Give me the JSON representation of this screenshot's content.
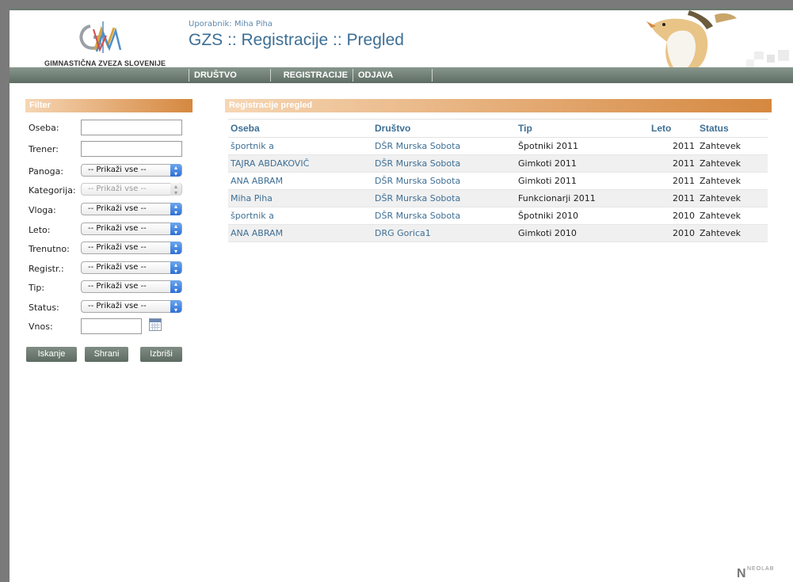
{
  "header": {
    "logo_text": "GIMNASTIČNA ZVEZA SLOVENIJE",
    "user_label": "Uporabnik: Miha Piha",
    "title": "GZS :: Registracije :: Pregled"
  },
  "nav": {
    "items": [
      {
        "label": "DRUŠTVO"
      },
      {
        "label": "REGISTRACIJE"
      },
      {
        "label": "ODJAVA"
      }
    ]
  },
  "filter": {
    "heading": "Filter",
    "fields": {
      "oseba": {
        "label": "Oseba:",
        "value": ""
      },
      "trener": {
        "label": "Trener:",
        "value": ""
      },
      "panoga": {
        "label": "Panoga:",
        "selected": "-- Prikaži vse --"
      },
      "kategorija": {
        "label": "Kategorija:",
        "selected": "-- Prikaži vse --"
      },
      "vloga": {
        "label": "Vloga:",
        "selected": "-- Prikaži vse --"
      },
      "leto": {
        "label": "Leto:",
        "selected": "-- Prikaži vse --"
      },
      "trenutno": {
        "label": "Trenutno:",
        "selected": "-- Prikaži vse --"
      },
      "registr": {
        "label": "Registr.:",
        "selected": "-- Prikaži vse --"
      },
      "tip": {
        "label": "Tip:",
        "selected": "-- Prikaži vse --"
      },
      "status": {
        "label": "Status:",
        "selected": "-- Prikaži vse --"
      },
      "vnos": {
        "label": "Vnos:",
        "value": ""
      }
    },
    "buttons": {
      "search": "Iskanje",
      "save": "Shrani",
      "delete": "Izbriši"
    }
  },
  "grid": {
    "heading": "Registracije pregled",
    "columns": [
      "Oseba",
      "Društvo",
      "Tip",
      "Leto",
      "Status"
    ],
    "rows": [
      {
        "oseba": "športnik a",
        "drustvo": "DŠR Murska Sobota",
        "tip": "Špotniki 2011",
        "leto": "2011",
        "status": "Zahtevek"
      },
      {
        "oseba": "TAJRA ABDAKOVIČ",
        "drustvo": "DŠR Murska Sobota",
        "tip": "Gimkoti 2011",
        "leto": "2011",
        "status": "Zahtevek"
      },
      {
        "oseba": "ANA ABRAM",
        "drustvo": "DŠR Murska Sobota",
        "tip": "Gimkoti 2011",
        "leto": "2011",
        "status": "Zahtevek"
      },
      {
        "oseba": "Miha Piha",
        "drustvo": "DŠR Murska Sobota",
        "tip": "Funkcionarji 2011",
        "leto": "2011",
        "status": "Zahtevek"
      },
      {
        "oseba": "športnik a",
        "drustvo": "DŠR Murska Sobota",
        "tip": "Špotniki 2010",
        "leto": "2010",
        "status": "Zahtevek"
      },
      {
        "oseba": "ANA ABRAM",
        "drustvo": "DRG Gorica1",
        "tip": "Gimkoti 2010",
        "leto": "2010",
        "status": "Zahtevek"
      }
    ]
  },
  "footer": {
    "brand": "NEOLAB"
  },
  "colors": {
    "accent": "#3e6f95",
    "nav_bar": "#6d7b71",
    "section_orange": "#d58840"
  }
}
